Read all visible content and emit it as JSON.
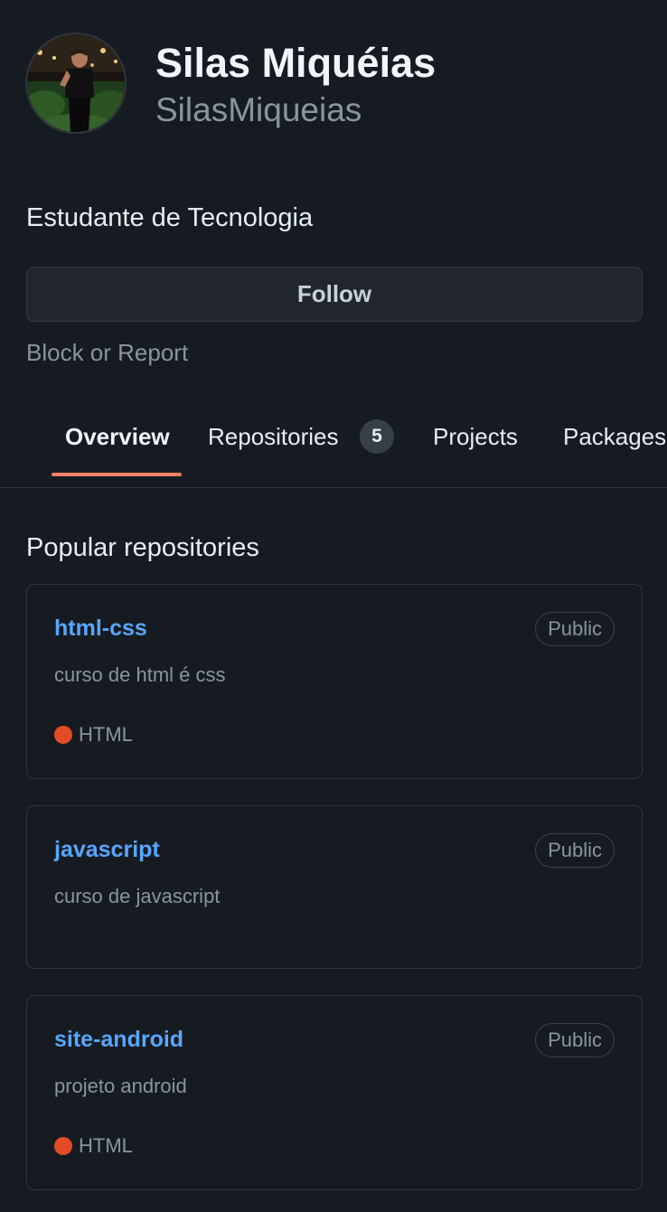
{
  "profile": {
    "display_name": "Silas Miquéias",
    "username": "SilasMiqueias",
    "bio": "Estudante de Tecnologia"
  },
  "actions": {
    "follow_label": "Follow",
    "block_report_label": "Block or Report"
  },
  "tabs": [
    {
      "label": "Overview",
      "active": true
    },
    {
      "label": "Repositories",
      "count": "5"
    },
    {
      "label": "Projects"
    },
    {
      "label": "Packages"
    }
  ],
  "popular": {
    "title": "Popular repositories",
    "repos": [
      {
        "name": "html-css",
        "visibility": "Public",
        "description": "curso de html é css",
        "language": "HTML",
        "language_color": "#e34c26"
      },
      {
        "name": "javascript",
        "visibility": "Public",
        "description": "curso de javascript"
      },
      {
        "name": "site-android",
        "visibility": "Public",
        "description": "projeto android",
        "language": "HTML",
        "language_color": "#e34c26"
      }
    ]
  },
  "colors": {
    "background": "#161b22",
    "link": "#58a6ff",
    "active_tab_underline": "#f78166"
  }
}
